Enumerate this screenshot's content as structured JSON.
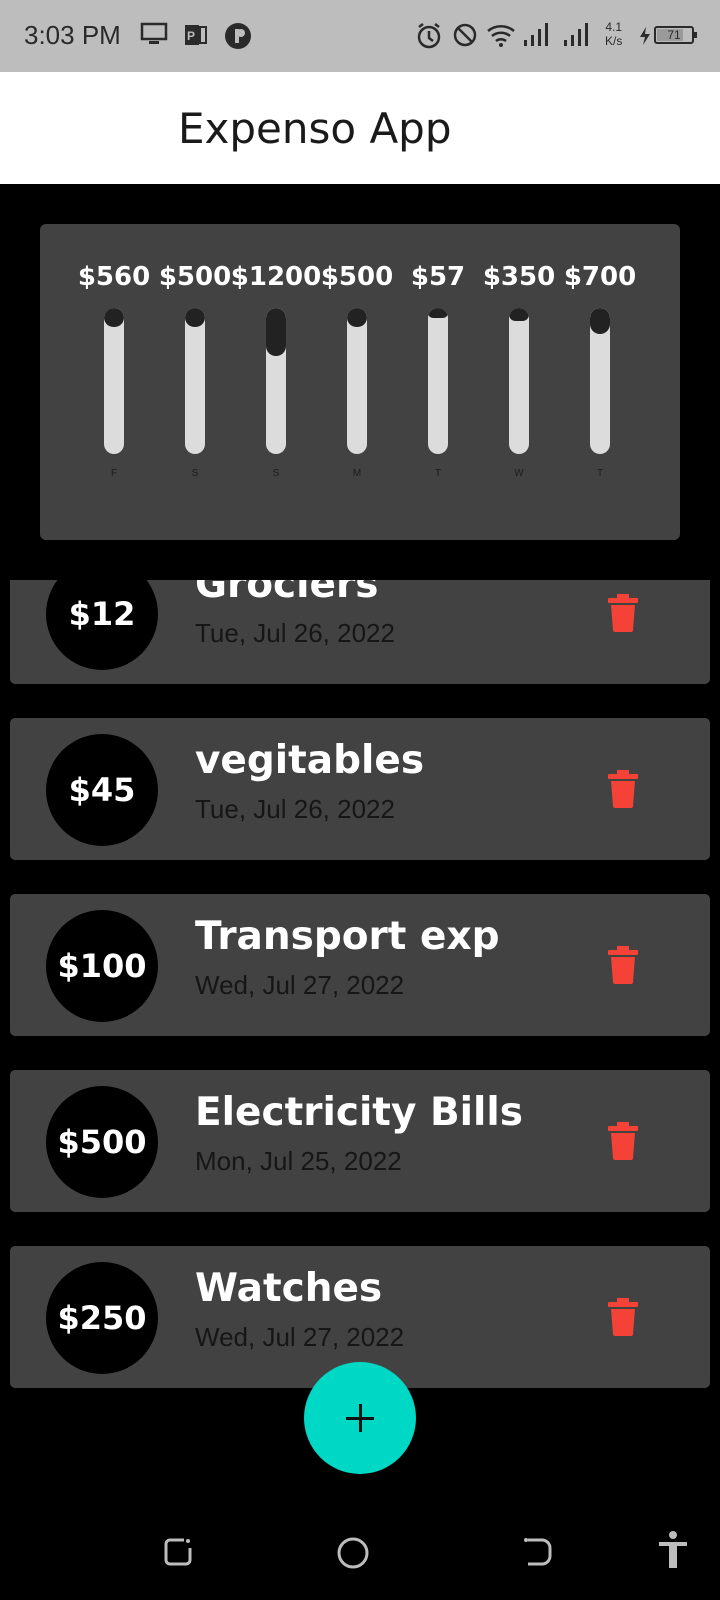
{
  "status_bar": {
    "time": "3:03 PM",
    "speed_value": "4.1",
    "speed_unit": "K/s",
    "battery_level": "71",
    "icons": [
      "monitor-icon",
      "office-icon",
      "app-icon",
      "alarm-icon",
      "dnd-icon",
      "wifi-icon",
      "signal-icon",
      "signal-icon",
      "charging-icon"
    ]
  },
  "app": {
    "title": "Expenso App"
  },
  "chart_data": {
    "type": "bar",
    "categories": [
      "F",
      "S",
      "S",
      "M",
      "T",
      "W",
      "T"
    ],
    "labels": [
      "$560",
      "$500",
      "$1200",
      "$500",
      "$57",
      "$350",
      "$700"
    ],
    "values": [
      560,
      500,
      1200,
      500,
      57,
      350,
      700
    ],
    "fill_fraction": [
      0.13,
      0.13,
      0.33,
      0.13,
      0.03,
      0.09,
      0.18
    ]
  },
  "transactions": [
    {
      "amount": "$12",
      "title": "Grociers",
      "date": "Tue, Jul 26, 2022"
    },
    {
      "amount": "$45",
      "title": "vegitables",
      "date": "Tue, Jul 26, 2022"
    },
    {
      "amount": "$100",
      "title": "Transport exp",
      "date": "Wed, Jul 27, 2022"
    },
    {
      "amount": "$500",
      "title": "Electricity Bills",
      "date": "Mon, Jul 25, 2022"
    },
    {
      "amount": "$250",
      "title": "Watches",
      "date": "Wed, Jul 27, 2022"
    }
  ],
  "colors": {
    "background": "#000000",
    "card": "#424242",
    "fab": "#00d8c6",
    "delete": "#f44336",
    "status_bar": "#bdbdbd"
  },
  "fab": {
    "icon": "plus-icon"
  },
  "nav": {
    "icons": [
      "recent-apps-icon",
      "home-icon",
      "back-icon",
      "accessibility-icon"
    ]
  }
}
